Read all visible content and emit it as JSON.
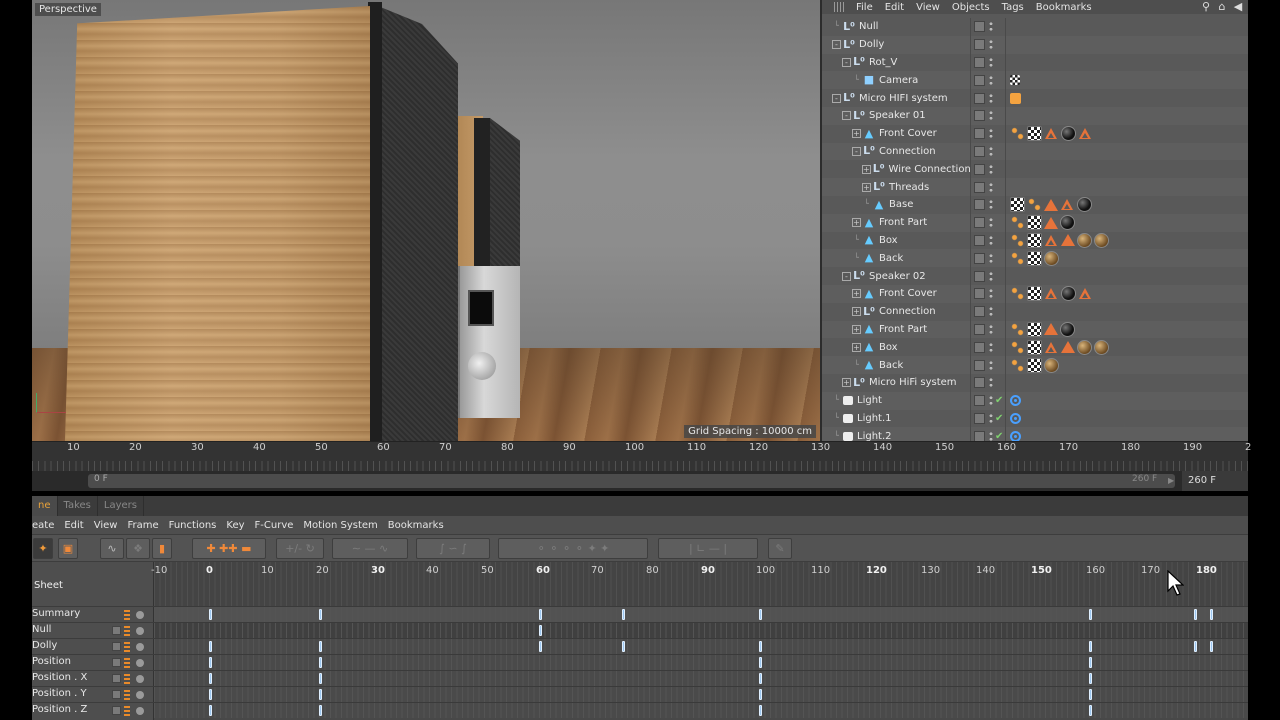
{
  "viewport": {
    "label": "Perspective",
    "grid_spacing": "Grid Spacing : 10000 cm"
  },
  "object_manager": {
    "menu": [
      "File",
      "Edit",
      "View",
      "Objects",
      "Tags",
      "Bookmarks"
    ],
    "objects": [
      {
        "name": "Null",
        "icon": "null",
        "indent": 0,
        "expand": "",
        "tags": []
      },
      {
        "name": "Dolly",
        "icon": "null",
        "indent": 0,
        "expand": "-",
        "tags": []
      },
      {
        "name": "Rot_V",
        "icon": "null",
        "indent": 1,
        "expand": "-",
        "tags": []
      },
      {
        "name": "Camera",
        "icon": "camera",
        "indent": 2,
        "expand": "",
        "tags": [
          "cam-target"
        ]
      },
      {
        "name": "Micro HIFI system",
        "icon": "null",
        "indent": 0,
        "expand": "-",
        "tags": [
          "compositing"
        ]
      },
      {
        "name": "Speaker 01",
        "icon": "null",
        "indent": 1,
        "expand": "-",
        "tags": []
      },
      {
        "name": "Front Cover",
        "icon": "poly",
        "indent": 2,
        "expand": "+",
        "tags": [
          "uv",
          "checker",
          "tri-l",
          "ball-black",
          "tri-l"
        ]
      },
      {
        "name": "Connection",
        "icon": "null",
        "indent": 2,
        "expand": "-",
        "tags": []
      },
      {
        "name": "Wire Connection",
        "icon": "null",
        "indent": 3,
        "expand": "+",
        "tags": []
      },
      {
        "name": "Threads",
        "icon": "null",
        "indent": 3,
        "expand": "+",
        "tags": []
      },
      {
        "name": "Base",
        "icon": "poly",
        "indent": 3,
        "expand": "",
        "tags": [
          "checker",
          "uv",
          "tri-o",
          "tri-l",
          "ball-black"
        ]
      },
      {
        "name": "Front Part",
        "icon": "poly",
        "indent": 2,
        "expand": "+",
        "tags": [
          "uv",
          "checker",
          "tri-o",
          "ball-black"
        ]
      },
      {
        "name": "Box",
        "icon": "poly",
        "indent": 2,
        "expand": "",
        "tags": [
          "uv",
          "checker",
          "tri-l",
          "tri-o",
          "ball-gold",
          "ball-gold"
        ]
      },
      {
        "name": "Back",
        "icon": "poly",
        "indent": 2,
        "expand": "",
        "tags": [
          "uv",
          "checker",
          "ball-gold"
        ]
      },
      {
        "name": "Speaker 02",
        "icon": "null",
        "indent": 1,
        "expand": "-",
        "tags": []
      },
      {
        "name": "Front Cover",
        "icon": "poly",
        "indent": 2,
        "expand": "+",
        "tags": [
          "uv",
          "checker",
          "tri-l",
          "ball-black",
          "tri-l"
        ]
      },
      {
        "name": "Connection",
        "icon": "null",
        "indent": 2,
        "expand": "+",
        "tags": []
      },
      {
        "name": "Front Part",
        "icon": "poly",
        "indent": 2,
        "expand": "+",
        "tags": [
          "uv",
          "checker",
          "tri-o",
          "ball-black"
        ]
      },
      {
        "name": "Box",
        "icon": "poly",
        "indent": 2,
        "expand": "+",
        "tags": [
          "uv",
          "checker",
          "tri-l",
          "tri-o",
          "ball-gold",
          "ball-gold"
        ]
      },
      {
        "name": "Back",
        "icon": "poly",
        "indent": 2,
        "expand": "",
        "tags": [
          "uv",
          "checker",
          "ball-gold"
        ]
      },
      {
        "name": "Micro HiFi system",
        "icon": "null",
        "indent": 1,
        "expand": "+",
        "tags": []
      },
      {
        "name": "Light",
        "icon": "light",
        "indent": 0,
        "expand": "",
        "tags": [
          "target"
        ],
        "check": true
      },
      {
        "name": "Light.1",
        "icon": "light",
        "indent": 0,
        "expand": "",
        "tags": [
          "target"
        ],
        "check": true
      },
      {
        "name": "Light.2",
        "icon": "light",
        "indent": 0,
        "expand": "",
        "tags": [
          "target"
        ],
        "check": true
      }
    ]
  },
  "timeline_ruler": {
    "ticks": [
      "10",
      "20",
      "30",
      "40",
      "50",
      "60",
      "70",
      "80",
      "90",
      "100",
      "110",
      "120",
      "130",
      "140",
      "150",
      "160",
      "170",
      "180",
      "190",
      "2"
    ],
    "range_start": "0 F",
    "range_end": "260 F",
    "range_field": "260 F"
  },
  "timeline": {
    "tabs": [
      "ne",
      "Takes",
      "Layers"
    ],
    "menu": [
      "eate",
      "Edit",
      "View",
      "Frame",
      "Functions",
      "Key",
      "F-Curve",
      "Motion System",
      "Bookmarks"
    ],
    "sheet_label": "Sheet",
    "frame_ticks": [
      {
        "label": "-10",
        "frame": -10,
        "bold": false
      },
      {
        "label": "0",
        "frame": 0,
        "bold": true
      },
      {
        "label": "10",
        "frame": 10,
        "bold": false
      },
      {
        "label": "20",
        "frame": 20,
        "bold": false
      },
      {
        "label": "30",
        "frame": 30,
        "bold": true
      },
      {
        "label": "40",
        "frame": 40,
        "bold": false
      },
      {
        "label": "50",
        "frame": 50,
        "bold": false
      },
      {
        "label": "60",
        "frame": 60,
        "bold": true
      },
      {
        "label": "70",
        "frame": 70,
        "bold": false
      },
      {
        "label": "80",
        "frame": 80,
        "bold": false
      },
      {
        "label": "90",
        "frame": 90,
        "bold": true
      },
      {
        "label": "100",
        "frame": 100,
        "bold": false
      },
      {
        "label": "110",
        "frame": 110,
        "bold": false
      },
      {
        "label": "120",
        "frame": 120,
        "bold": true
      },
      {
        "label": "130",
        "frame": 130,
        "bold": false
      },
      {
        "label": "140",
        "frame": 140,
        "bold": false
      },
      {
        "label": "150",
        "frame": 150,
        "bold": true
      },
      {
        "label": "160",
        "frame": 160,
        "bold": false
      },
      {
        "label": "170",
        "frame": 170,
        "bold": false
      },
      {
        "label": "180",
        "frame": 180,
        "bold": true
      }
    ],
    "tracks": [
      {
        "name": "Summary",
        "kind": "summary",
        "keys": [
          0,
          20,
          60,
          75,
          100,
          160,
          179,
          182
        ]
      },
      {
        "name": "Null",
        "kind": "null",
        "keys": [
          60
        ]
      },
      {
        "name": "Dolly",
        "kind": "obj",
        "keys": [
          0,
          20,
          60,
          75,
          100,
          160,
          179,
          182
        ]
      },
      {
        "name": "Position",
        "kind": "param",
        "keys": [
          0,
          20,
          100,
          160
        ]
      },
      {
        "name": "Position . X",
        "kind": "param",
        "keys": [
          0,
          20,
          100,
          160
        ]
      },
      {
        "name": "Position . Y",
        "kind": "param",
        "keys": [
          0,
          20,
          100,
          160
        ]
      },
      {
        "name": "Position . Z",
        "kind": "param",
        "keys": [
          0,
          20,
          100,
          160
        ]
      }
    ]
  }
}
